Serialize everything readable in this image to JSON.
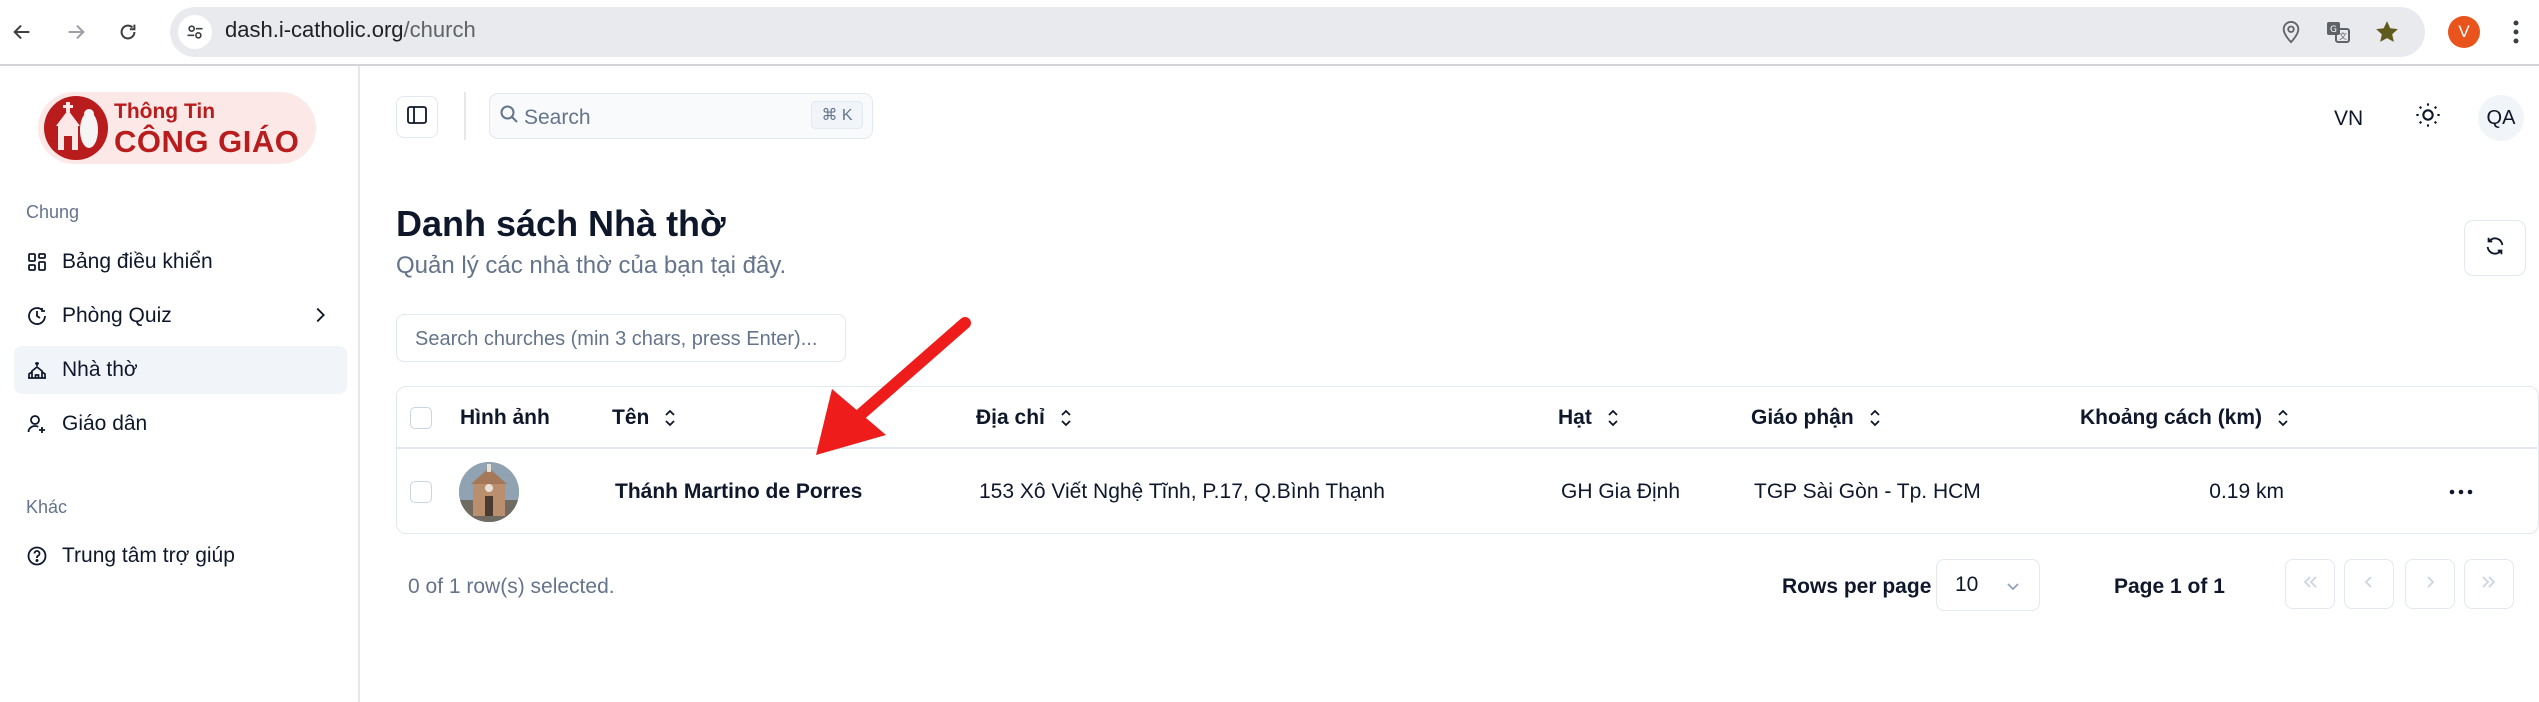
{
  "browser": {
    "url_host": "dash.i-catholic.org",
    "url_path": "/church",
    "profile_initial": "V",
    "colors": {
      "profile": "#e8541c",
      "bookmark_star": "#5f5a1d"
    }
  },
  "sidebar": {
    "logo": {
      "line1": "Thông Tin",
      "line2": "CÔNG GIÁO"
    },
    "sections": [
      {
        "label": "Chung",
        "items": [
          {
            "label": "Bảng điều khiển",
            "icon": "dashboard-icon"
          },
          {
            "label": "Phòng Quiz",
            "icon": "clock-icon",
            "has_chevron": true
          },
          {
            "label": "Nhà thờ",
            "icon": "church-icon",
            "active": true
          },
          {
            "label": "Giáo dân",
            "icon": "user-icon"
          }
        ]
      },
      {
        "label": "Khác",
        "items": [
          {
            "label": "Trung tâm trợ giúp",
            "icon": "help-circle-icon"
          }
        ]
      }
    ]
  },
  "header": {
    "search_placeholder": "Search",
    "search_shortcut": "⌘ K",
    "language": "VN",
    "user_initials": "QA"
  },
  "page": {
    "title": "Danh sách Nhà thờ",
    "subtitle": "Quản lý các nhà thờ của bạn tại đây.",
    "filter_placeholder": "Search churches (min 3 chars, press Enter)..."
  },
  "table": {
    "columns": [
      "Hình ảnh",
      "Tên",
      "Địa chỉ",
      "Hạt",
      "Giáo phận",
      "Khoảng cách (km)"
    ],
    "rows": [
      {
        "name": "Thánh Martino de Porres",
        "address": "153 Xô Viết Nghệ Tĩnh, P.17, Q.Bình Thạnh",
        "deanery": "GH Gia Định",
        "diocese": "TGP Sài Gòn - Tp. HCM",
        "distance": "0.19 km"
      }
    ]
  },
  "footer": {
    "selection_info": "0 of 1 row(s) selected.",
    "rows_per_page_label": "Rows per page",
    "rows_per_page_value": "10",
    "page_info": "Page 1 of 1"
  },
  "annotation": {
    "arrow_color": "#ef1c1c"
  }
}
